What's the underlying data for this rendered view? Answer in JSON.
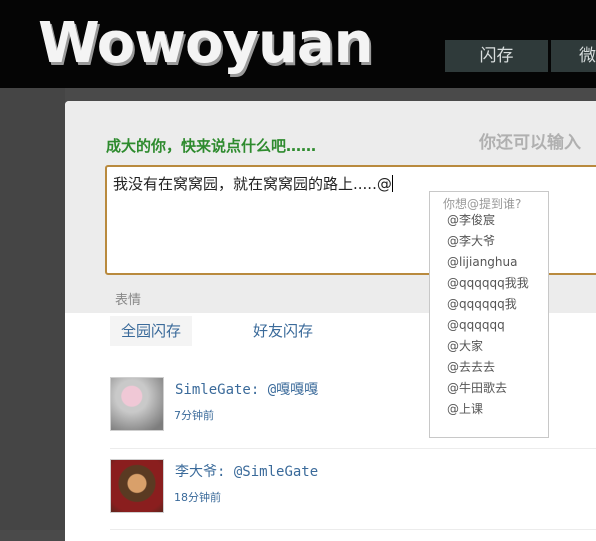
{
  "header": {
    "logo": "Wowoyuan",
    "nav": [
      {
        "label": "闪存"
      },
      {
        "label": "微"
      }
    ]
  },
  "compose": {
    "prompt": "成大的你，快来说点什么吧……",
    "remaining_label": "你还可以输入",
    "text": "我没有在窝窝园，就在窝窝园的路上.....@",
    "emoji_label": "表情"
  },
  "mention_dropdown": {
    "title": "你想@提到谁?",
    "options": [
      "@李俊宸",
      "@李大爷",
      "@lijianghua",
      "@qqqqqq我我",
      "@qqqqqq我",
      "@qqqqqq",
      "@大家",
      "@去去去",
      "@牛田歌去",
      "@上课"
    ]
  },
  "tabs": [
    {
      "label": "全园闪存"
    },
    {
      "label": "好友闪存"
    }
  ],
  "feed": [
    {
      "author": "SimleGate",
      "separator": ":",
      "mention": "@嘎嘎嘎",
      "time": "7分钟前"
    },
    {
      "author": "李大爷",
      "separator": ":",
      "mention": "@SimleGate",
      "time": "18分钟前"
    }
  ]
}
